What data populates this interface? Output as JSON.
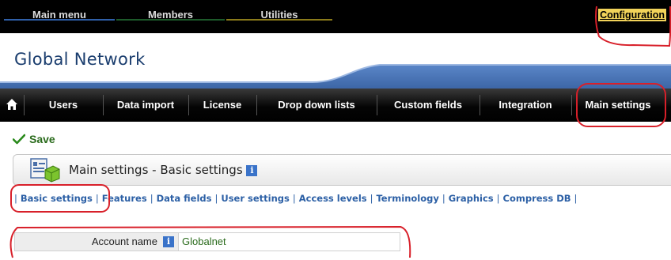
{
  "top_menu": {
    "tabs": [
      "Main menu",
      "Members",
      "Utilities"
    ],
    "configuration": "Configuration"
  },
  "brand": "Global Network",
  "nav": {
    "items": [
      "Users",
      "Data import",
      "License",
      "Drop down lists",
      "Custom fields",
      "Integration",
      "Main settings"
    ]
  },
  "save_label": "Save",
  "header": {
    "title": "Main settings - Basic settings"
  },
  "sub_links": [
    "Basic settings",
    "Features",
    "Data fields",
    "User settings",
    "Access levels",
    "Terminology",
    "Graphics",
    "Compress DB"
  ],
  "account": {
    "label": "Account name",
    "value": "Globalnet"
  },
  "colors": {
    "accent_blue": "#4a6fa8",
    "highlight_red": "#d8202a",
    "save_green": "#2a6b1c"
  }
}
